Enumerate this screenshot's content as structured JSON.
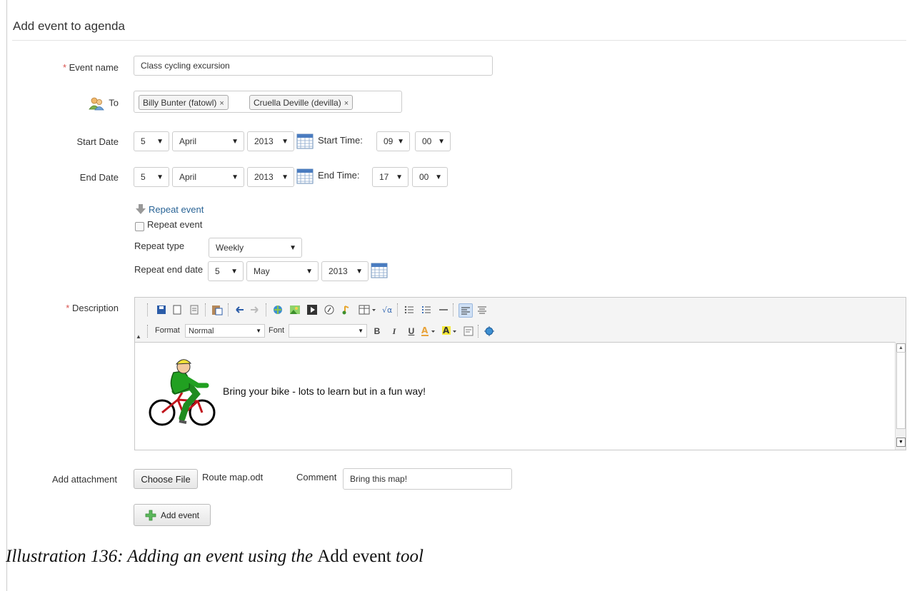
{
  "page": {
    "title": "Add event to agenda"
  },
  "event_name": {
    "label": "Event name",
    "required_mark": "*",
    "value": "Class cycling excursion"
  },
  "to": {
    "label": "To",
    "recipients": [
      "Billy Bunter (fatowl)",
      "Cruella Deville (devilla)"
    ],
    "remove_glyph": "×"
  },
  "start": {
    "label": "Start Date",
    "day": "5",
    "month": "April",
    "year": "2013",
    "time_label": "Start Time:",
    "hour": "09",
    "minute": "00"
  },
  "end": {
    "label": "End Date",
    "day": "5",
    "month": "April",
    "year": "2013",
    "time_label": "End Time:",
    "hour": "17",
    "minute": "00"
  },
  "repeat": {
    "toggle_link": "Repeat event",
    "checkbox_label": "Repeat event",
    "checked": false,
    "type_label": "Repeat type",
    "type_value": "Weekly",
    "end_label": "Repeat end date",
    "end_day": "5",
    "end_month": "May",
    "end_year": "2013"
  },
  "description": {
    "label": "Description",
    "required_mark": "*",
    "format_label": "Format",
    "format_value": "Normal",
    "font_label": "Font",
    "font_value": "",
    "content_text": "Bring your bike - lots to learn but in a fun way!"
  },
  "attachment": {
    "label": "Add attachment",
    "choose_button": "Choose File",
    "filename": "Route map.odt",
    "comment_label": "Comment",
    "comment_value": "Bring this map!"
  },
  "submit": {
    "label": "Add event"
  },
  "caption": {
    "prefix": "Illustration 136: Adding an event using the ",
    "tool_name": "Add event",
    "suffix": " tool"
  },
  "colors": {
    "accent_link": "#2a6496",
    "required": "#d9534f",
    "add_icon": "#5cb85c"
  }
}
